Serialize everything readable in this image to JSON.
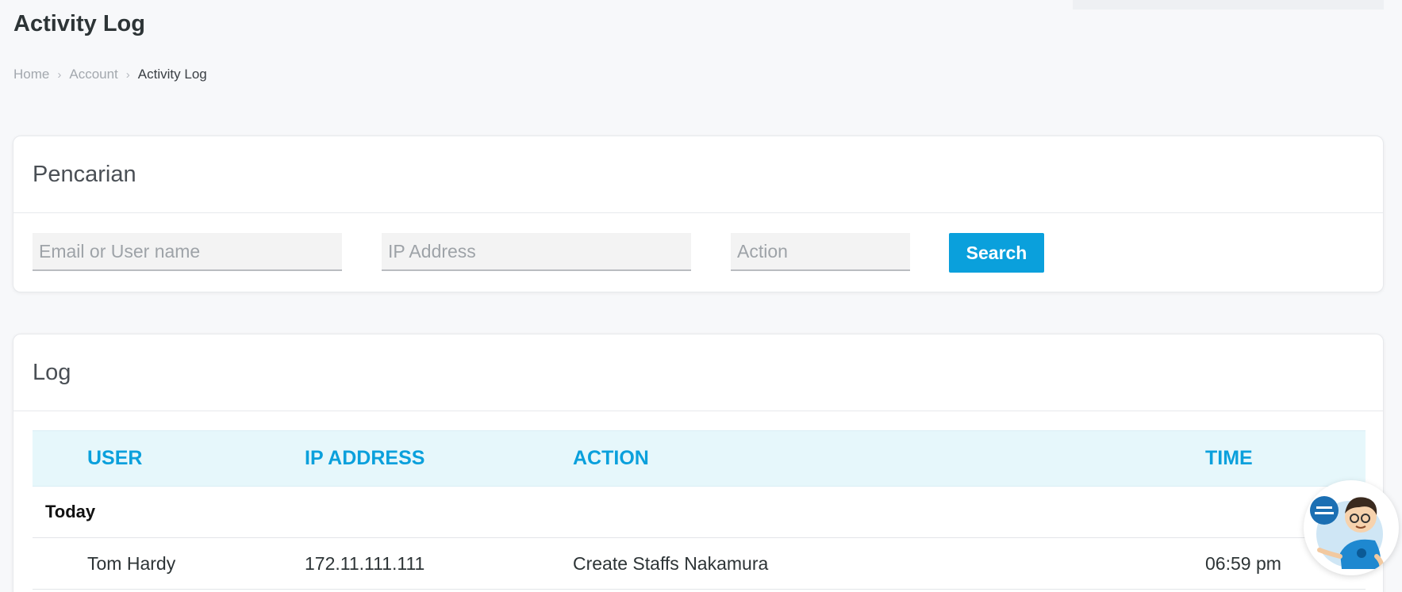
{
  "page": {
    "title": "Activity Log"
  },
  "breadcrumb": {
    "items": [
      "Home",
      "Account",
      "Activity Log"
    ]
  },
  "search_card": {
    "title": "Pencarian",
    "fields": {
      "user_placeholder": "Email or User name",
      "ip_placeholder": "IP Address",
      "action_placeholder": "Action"
    },
    "button_label": "Search"
  },
  "log_card": {
    "title": "Log",
    "columns": [
      "USER",
      "IP ADDRESS",
      "ACTION",
      "TIME"
    ],
    "groups": [
      {
        "label": "Today",
        "rows": [
          {
            "user": "Tom Hardy",
            "ip": "172.11.111.111",
            "action": "Create Staffs Nakamura",
            "time": "06:59 pm"
          }
        ]
      }
    ]
  },
  "colors": {
    "accent": "#0aa0dc",
    "header_bg": "#e6f7fb",
    "page_bg": "#f7f8fa"
  },
  "icons": {
    "chat_widget": "support-agent-icon"
  }
}
